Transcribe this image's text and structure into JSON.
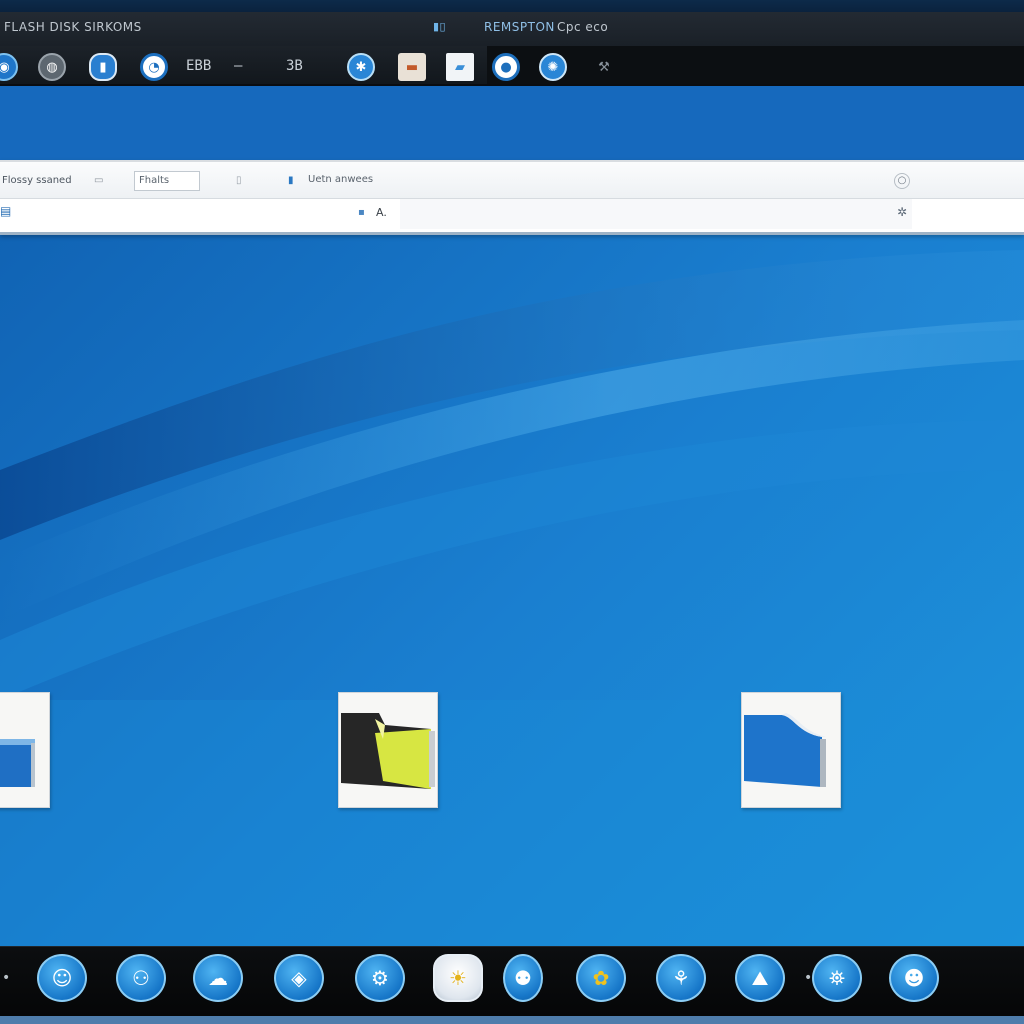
{
  "window": {
    "title_left": "FLASH DISK SIRKOMS",
    "title_right": "REMSPTON",
    "title_far": "Cpc eco"
  },
  "toolbar": {
    "items": [
      {
        "name": "network-icon",
        "label": ""
      },
      {
        "name": "disk-icon",
        "label": ""
      },
      {
        "name": "drive-icon",
        "label": ""
      },
      {
        "name": "clock-icon",
        "label": ""
      },
      {
        "name": "text-a",
        "label": "EBB"
      },
      {
        "name": "dash",
        "label": "—"
      },
      {
        "name": "text-b",
        "label": "ЗВ"
      },
      {
        "name": "settings-icon",
        "label": ""
      },
      {
        "name": "folder-icon",
        "label": ""
      },
      {
        "name": "image-icon",
        "label": ""
      },
      {
        "name": "camera-icon",
        "label": ""
      },
      {
        "name": "globe-icon",
        "label": ""
      },
      {
        "name": "tools-icon",
        "label": ""
      }
    ]
  },
  "explorer": {
    "ribbon_left_label": "Flossy ssaned",
    "ribbon_box_label": "Fhalts",
    "ribbon_field_label": "Uetn anwees",
    "address_mark": "A."
  },
  "dock": {
    "items": [
      {
        "name": "dock-app-1-icon",
        "glyph": "☺"
      },
      {
        "name": "dock-app-2-icon",
        "glyph": "⚇"
      },
      {
        "name": "dock-app-3-icon",
        "glyph": "☁"
      },
      {
        "name": "dock-app-4-icon",
        "glyph": "◈"
      },
      {
        "name": "dock-app-5-icon",
        "glyph": "⚙"
      },
      {
        "name": "dock-app-6-icon",
        "glyph": "☀"
      },
      {
        "name": "dock-app-7-icon",
        "glyph": "⚉"
      },
      {
        "name": "dock-app-8-icon",
        "glyph": "✿"
      },
      {
        "name": "dock-app-9-icon",
        "glyph": "⚘"
      },
      {
        "name": "dock-app-10-icon",
        "glyph": "⛰"
      },
      {
        "name": "dock-app-11-icon",
        "glyph": "⛯"
      },
      {
        "name": "dock-app-12-icon",
        "glyph": "☻"
      }
    ]
  },
  "colors": {
    "wallpaper_base": "#1a78c9",
    "wallpaper_light": "#2b9ae0",
    "wallpaper_dark": "#0b4f9a",
    "accent": "#1676c8"
  }
}
